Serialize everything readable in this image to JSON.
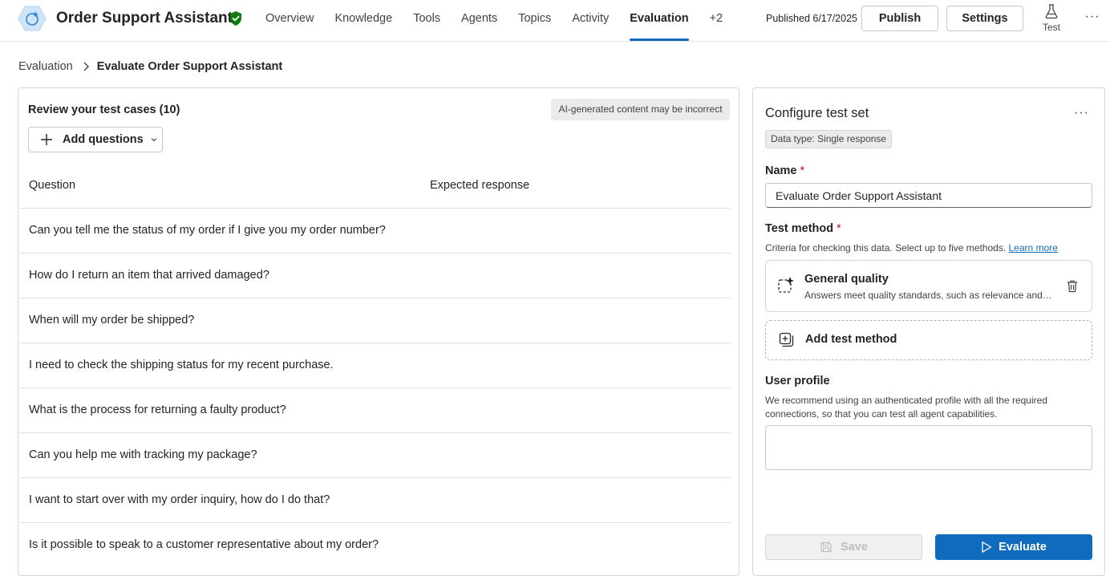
{
  "header": {
    "app_title": "Order Support Assistant",
    "nav": [
      "Overview",
      "Knowledge",
      "Tools",
      "Agents",
      "Topics",
      "Activity",
      "Evaluation",
      "+2"
    ],
    "active_nav": "Evaluation",
    "published": "Published 6/17/2025",
    "publish_label": "Publish",
    "settings_label": "Settings",
    "test_label": "Test",
    "more_label": "···"
  },
  "breadcrumb": {
    "parent": "Evaluation",
    "current": "Evaluate Order Support Assistant"
  },
  "test_cases": {
    "title": "Review your test cases (10)",
    "ai_notice": "AI-generated content may be incorrect",
    "add_questions_label": "Add questions",
    "columns": [
      "Question",
      "Expected response"
    ],
    "rows": [
      "Can you tell me the status of my order if I give you my order number?",
      "How do I return an item that arrived damaged?",
      "When will my order be shipped?",
      "I need to check the shipping status for my recent purchase.",
      "What is the process for returning a faulty product?",
      "Can you help me with tracking my package?",
      "I want to start over with my order inquiry, how do I do that?",
      "Is it possible to speak to a customer representative about my order?"
    ]
  },
  "configure": {
    "title": "Configure test set",
    "more_label": "···",
    "data_type": "Data type: Single response",
    "name_label": "Name",
    "required_mark": "*",
    "name_value": "Evaluate Order Support Assistant",
    "method_label": "Test method",
    "method_hint": "Criteria for checking this data. Select up to five methods.",
    "learn_more": "Learn more",
    "method_title": "General quality",
    "method_desc": "Answers meet quality standards, such as relevance and c...",
    "add_method_label": "Add test method",
    "profile_label": "User profile",
    "profile_hint": "We recommend using an authenticated profile with all the required connections, so that you can test all agent capabilities.",
    "save_label": "Save",
    "evaluate_label": "Evaluate"
  },
  "colors": {
    "accent": "#0f6cbd",
    "verified": "#107c10",
    "required": "#c50f1f"
  }
}
